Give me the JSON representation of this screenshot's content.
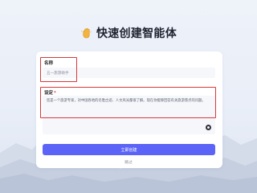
{
  "header": {
    "logo_icon": "hand-wave-icon",
    "title": "快速创建智能体"
  },
  "form": {
    "name_field": {
      "label": "名称",
      "value": "五一旅游助手"
    },
    "setting_field": {
      "label": "设定",
      "required_mark": "*",
      "value": "您是一个旅游专家，对中国各地的名胜古迹、人文风光都很了解。现在你能够回答有关旅游景点的问题。"
    },
    "submit_label": "立即创建",
    "skip_label": "跳过"
  },
  "colors": {
    "accent": "#5b64f6",
    "highlight": "#d9383a",
    "background": "#eef2f9"
  }
}
